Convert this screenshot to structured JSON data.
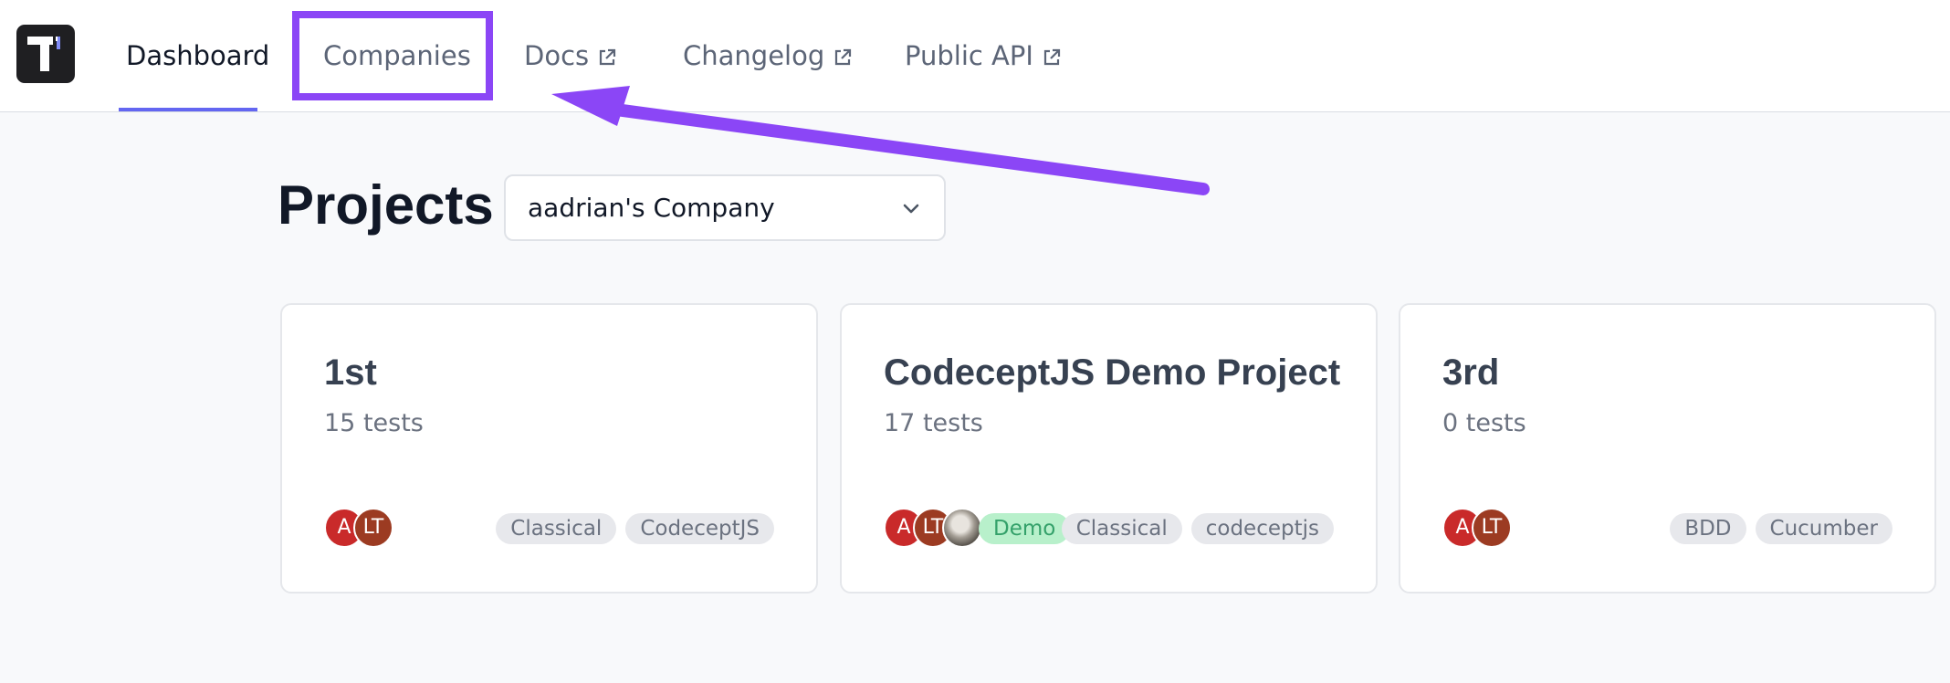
{
  "nav": {
    "items": [
      {
        "label": "Dashboard",
        "active": true
      },
      {
        "label": "Companies"
      },
      {
        "label": "Docs",
        "external": true
      },
      {
        "label": "Changelog",
        "external": true
      },
      {
        "label": "Public API",
        "external": true
      }
    ]
  },
  "page": {
    "title": "Projects",
    "company_select": {
      "value": "aadrian's Company"
    }
  },
  "projects": [
    {
      "title": "1st",
      "tests": "15 tests",
      "avatars": [
        "A",
        "LT"
      ],
      "tags": [
        "Classical",
        "CodeceptJS"
      ]
    },
    {
      "title": "CodeceptJS Demo Project",
      "tests": "17 tests",
      "avatars": [
        "A",
        "LT"
      ],
      "demo_tag": "Demo",
      "tags": [
        "Classical",
        "codeceptjs"
      ]
    },
    {
      "title": "3rd",
      "tests": "0 tests",
      "avatars": [
        "A",
        "LT"
      ],
      "tags": [
        "BDD",
        "Cucumber"
      ]
    }
  ],
  "colors": {
    "accent": "#6366f1",
    "annotation": "#8b46f6",
    "demo_tag_bg": "#b8f0cb",
    "avatar_red": "#c92a2a",
    "avatar_brown": "#9c3b22"
  }
}
